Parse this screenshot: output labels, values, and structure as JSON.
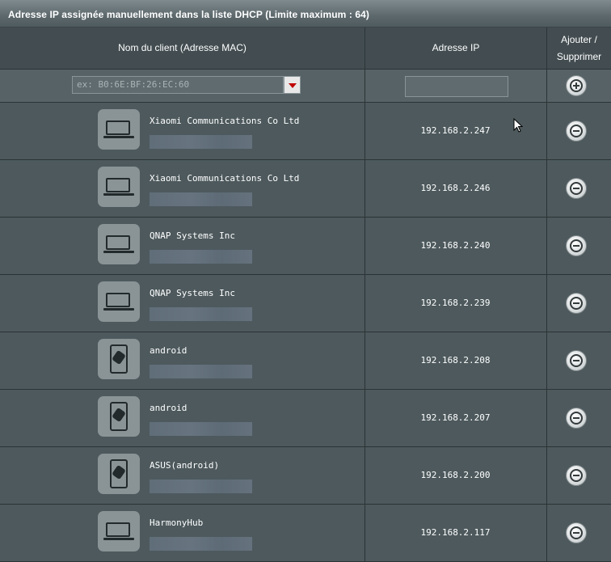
{
  "title": "Adresse IP assignée manuellement dans la liste DHCP (Limite maximum : 64)",
  "columns": {
    "client": "Nom du client (Adresse MAC)",
    "ip": "Adresse IP",
    "action_line1": "Ajouter /",
    "action_line2": "Supprimer"
  },
  "new_entry": {
    "mac_placeholder": "ex: B0:6E:BF:26:EC:60",
    "ip_value": ""
  },
  "icons": {
    "add": "plus-circle-icon",
    "delete": "minus-circle-icon",
    "dropdown": "triangle-down-icon",
    "laptop": "laptop-icon",
    "phone": "android-phone-icon"
  },
  "rows": [
    {
      "name": "Xiaomi Communications Co Ltd",
      "ip": "192.168.2.247",
      "device": "laptop"
    },
    {
      "name": "Xiaomi Communications Co Ltd",
      "ip": "192.168.2.246",
      "device": "laptop"
    },
    {
      "name": "QNAP Systems Inc",
      "ip": "192.168.2.240",
      "device": "laptop"
    },
    {
      "name": "QNAP Systems Inc",
      "ip": "192.168.2.239",
      "device": "laptop"
    },
    {
      "name": "android",
      "ip": "192.168.2.208",
      "device": "phone"
    },
    {
      "name": "android",
      "ip": "192.168.2.207",
      "device": "phone"
    },
    {
      "name": "ASUS(android)",
      "ip": "192.168.2.200",
      "device": "phone"
    },
    {
      "name": "HarmonyHub",
      "ip": "192.168.2.117",
      "device": "laptop"
    }
  ]
}
